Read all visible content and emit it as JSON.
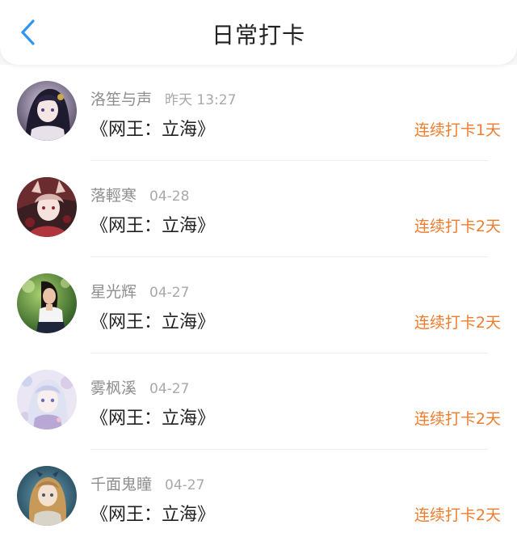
{
  "header": {
    "title": "日常打卡",
    "back_icon": "chevron-left-icon",
    "accent_color": "#2f97f0"
  },
  "colors": {
    "streak": "#f07c2e",
    "username": "#8e8e8e",
    "time": "#a9a9a9",
    "book": "#1f1f1f"
  },
  "entries": [
    {
      "username": "洛笙与声",
      "time": "昨天 13:27",
      "book": "《网王：立海》",
      "streak": "连续打卡1天",
      "avatar": "avatar-dark-hair-anime-girl"
    },
    {
      "username": "落輕寒",
      "time": "04-28",
      "book": "《网王：立海》",
      "streak": "连续打卡2天",
      "avatar": "avatar-fox-ear-anime-girl"
    },
    {
      "username": "星光辉",
      "time": "04-27",
      "book": "《网王：立海》",
      "streak": "连续打卡2天",
      "avatar": "avatar-photo-girl-green-background"
    },
    {
      "username": "雾枫溪",
      "time": "04-27",
      "book": "《网王：立海》",
      "streak": "连续打卡2天",
      "avatar": "avatar-pastel-anime-girl"
    },
    {
      "username": "千面鬼瞳",
      "time": "04-27",
      "book": "《网王：立海》",
      "streak": "连续打卡2天",
      "avatar": "avatar-blonde-doll-girl"
    }
  ]
}
